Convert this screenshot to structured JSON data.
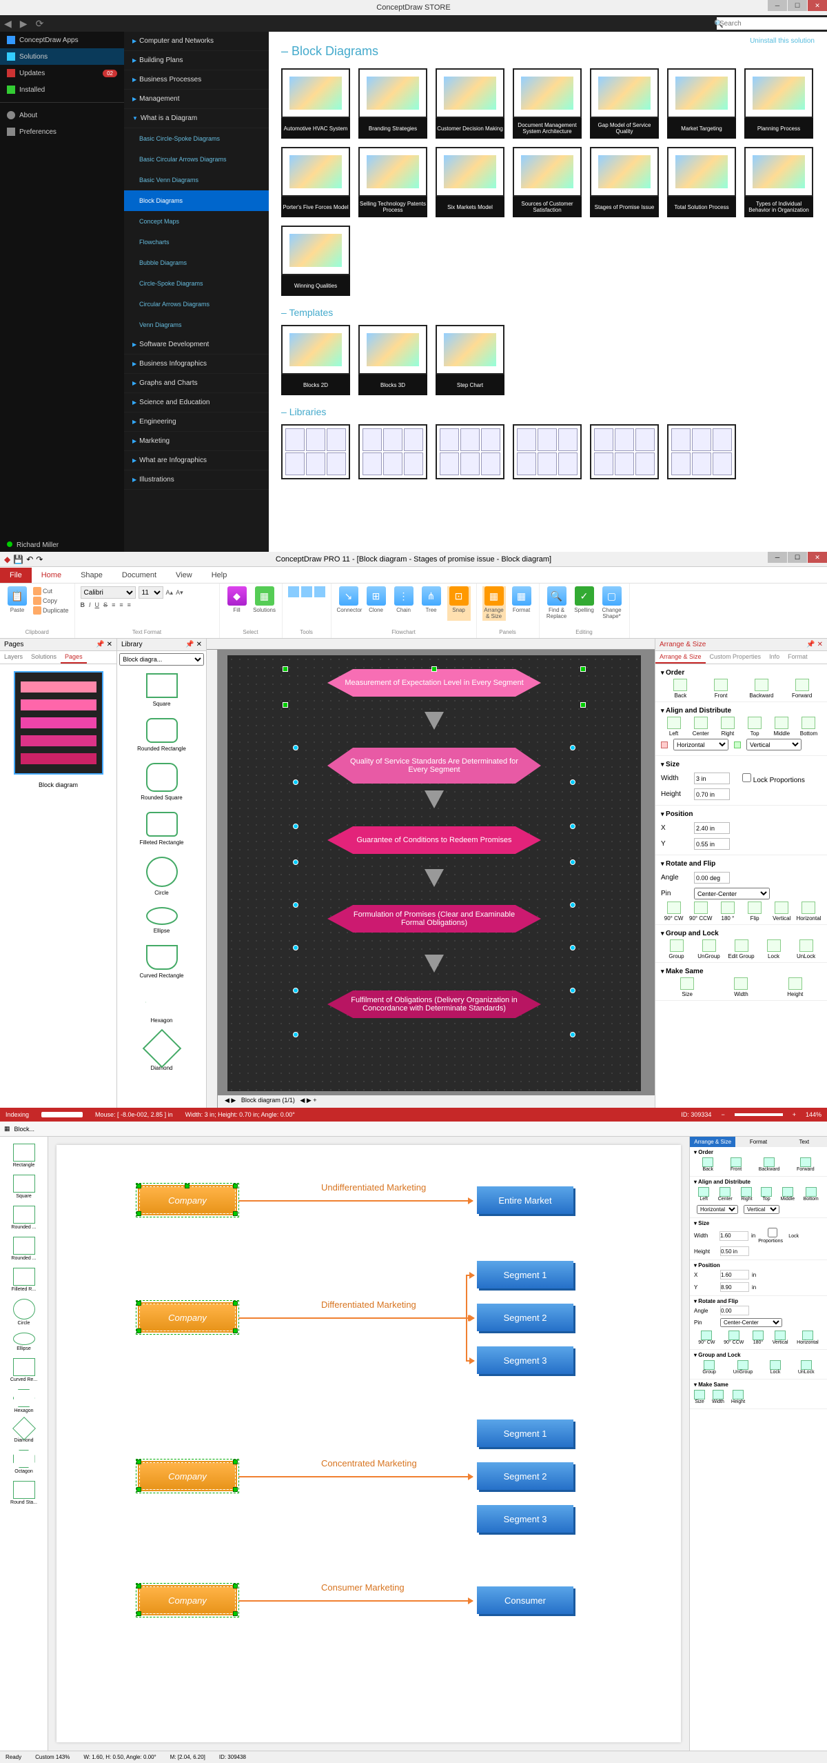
{
  "store": {
    "title": "ConceptDraw STORE",
    "search_placeholder": "Search",
    "uninstall": "Uninstall this solution",
    "leftnav": {
      "apps": "ConceptDraw Apps",
      "solutions": "Solutions",
      "updates": "Updates",
      "updates_badge": "02",
      "installed": "Installed",
      "about": "About",
      "preferences": "Preferences",
      "user": "Richard Miller"
    },
    "categories": [
      "Computer and Networks",
      "Building Plans",
      "Business Processes",
      "Management",
      "What is a Diagram"
    ],
    "subcats": [
      "Basic Circle-Spoke Diagrams",
      "Basic Circular Arrows Diagrams",
      "Basic Venn Diagrams",
      "Block Diagrams",
      "Concept Maps",
      "Flowcharts",
      "Bubble Diagrams",
      "Circle-Spoke Diagrams",
      "Circular Arrows Diagrams",
      "Venn Diagrams"
    ],
    "categories2": [
      "Software Development",
      "Business Infographics",
      "Graphs and Charts",
      "Science and Education",
      "Engineering",
      "Marketing",
      "What are Infographics",
      "Illustrations"
    ],
    "section_block": "Block Diagrams",
    "section_templates": "Templates",
    "section_libraries": "Libraries",
    "thumbs": [
      "Automotive HVAC System",
      "Branding Strategies",
      "Customer Decision Making",
      "Document Management System Architecture",
      "Gap Model of Service Quality",
      "Market Targeting",
      "Planning Process",
      "Porter's Five Forces Model",
      "Selling Technology Patents Process",
      "Six Markets Model",
      "Sources of Customer Satisfaction",
      "Stages of Promise Issue",
      "Total Solution Process",
      "Types of Individual Behavior in Organization",
      "Winning Qualities"
    ],
    "templates": [
      "Blocks 2D",
      "Blocks 3D",
      "Step Chart"
    ]
  },
  "pro": {
    "title": "ConceptDraw PRO 11 - [Block diagram - Stages of promise issue - Block diagram]",
    "tabs": [
      "File",
      "Home",
      "Shape",
      "Document",
      "View",
      "Help"
    ],
    "ribbon": {
      "paste": "Paste",
      "cut": "Cut",
      "copy": "Copy",
      "dup": "Duplicate",
      "font": "Calibri",
      "size": "11",
      "clipboard": "Clipboard",
      "textfmt": "Text Format",
      "fill": "Fill",
      "solutions": "Solutions",
      "select": "Select",
      "tools": "Tools",
      "connector": "Connector",
      "clone": "Clone",
      "chain": "Chain",
      "tree": "Tree",
      "snap": "Snap",
      "arrange": "Arrange & Size",
      "format": "Format",
      "flowchart": "Flowchart",
      "panels": "Panels",
      "find": "Find & Replace",
      "spelling": "Spelling",
      "change": "Change Shape*",
      "editing": "Editing"
    },
    "pages": {
      "title": "Pages",
      "tabs": [
        "Layers",
        "Solutions",
        "Pages"
      ],
      "caption": "Block diagram"
    },
    "library": {
      "title": "Library",
      "combo": "Block diagra...",
      "shapes": [
        "Square",
        "Rounded Rectangle",
        "Rounded Square",
        "Filleted Rectangle",
        "Circle",
        "Ellipse",
        "Curved Rectangle",
        "Hexagon",
        "Diamond"
      ]
    },
    "flow": [
      "Measurement of Expectation Level in Every Segment",
      "Quality of Service Standards Are Determinated for Every Segment",
      "Guarantee of Conditions to Redeem Promises",
      "Formulation of Promises (Clear and Examinable Formal Obligations)",
      "Fulfilment of Obligations (Delivery Organization in Concordance with Determinate Standards)"
    ],
    "canvas_tab": "Block diagram (1/1)",
    "arrange": {
      "title": "Arrange & Size",
      "tabs": [
        "Arrange & Size",
        "Custom Properties",
        "Info",
        "Format"
      ],
      "order": "Order",
      "order_items": [
        "Back",
        "Front",
        "Backward",
        "Forward"
      ],
      "align": "Align and Distribute",
      "align_items": [
        "Left",
        "Center",
        "Right",
        "Top",
        "Middle",
        "Bottom"
      ],
      "horiz": "Horizontal",
      "vert": "Vertical",
      "size": "Size",
      "width_l": "Width",
      "width_v": "3 in",
      "height_l": "Height",
      "height_v": "0.70 in",
      "lock": "Lock Proportions",
      "position": "Position",
      "x": "X",
      "x_v": "2.40 in",
      "y": "Y",
      "y_v": "0.55 in",
      "rotate": "Rotate and Flip",
      "angle_l": "Angle",
      "angle_v": "0.00 deg",
      "pin_l": "Pin",
      "pin_v": "Center-Center",
      "rotate_items": [
        "90° CW",
        "90° CCW",
        "180 °",
        "Flip",
        "Vertical",
        "Horizontal"
      ],
      "group": "Group and Lock",
      "group_items": [
        "Group",
        "UnGroup",
        "Edit Group",
        "Lock",
        "UnLock"
      ],
      "make": "Make Same",
      "make_items": [
        "Size",
        "Width",
        "Height"
      ]
    },
    "status": {
      "indexing": "Indexing",
      "mouse": "Mouse: [ -8.0e-002, 2.85 ] in",
      "dims": "Width: 3 in;  Height: 0.70 in;  Angle: 0.00°",
      "id": "ID: 309334",
      "zoom": "144%"
    }
  },
  "editor2": {
    "tb_block": "Block...",
    "shapes": [
      "Rectangle",
      "Square",
      "Rounded ...",
      "Rounded ...",
      "Filleted R...",
      "Circle",
      "Ellipse",
      "Curved Re...",
      "Hexagon",
      "Diamond",
      "Octagon",
      "Round Sta..."
    ],
    "right": {
      "tabs": [
        "Arrange & Size",
        "Format",
        "Text"
      ],
      "order": "Order",
      "order_i": [
        "Back",
        "Front",
        "Backward",
        "Forward"
      ],
      "align": "Align and Distribute",
      "align_i": [
        "Left",
        "Center",
        "Right",
        "Top",
        "Middle",
        "Bottom"
      ],
      "horiz": "Horizontal",
      "vert": "Vertical",
      "size": "Size",
      "w": "Width",
      "w_v": "1.60",
      "h": "Height",
      "h_v": "0.50 in",
      "lock": "Lock Proportions",
      "pos": "Position",
      "x": "X",
      "x_v": "1.60",
      "y": "Y",
      "y_v": "8.90",
      "in": "in",
      "rotate": "Rotate and Flip",
      "angle": "Angle",
      "angle_v": "0.00",
      "pin": "Pin",
      "pin_v": "Center-Center",
      "rot_i": [
        "90° CW",
        "90° CCW",
        "180°",
        "Vertical",
        "Horizontal"
      ],
      "group": "Group and Lock",
      "group_i": [
        "Group",
        "UnGroup",
        "Lock",
        "UnLock"
      ],
      "make": "Make Same",
      "make_i": [
        "Size",
        "Width",
        "Height"
      ]
    },
    "rows": [
      {
        "left": "Company",
        "label": "Undifferentiated Marketing",
        "rights": [
          "Entire Market"
        ]
      },
      {
        "left": "Company",
        "label": "Differentiated Marketing",
        "rights": [
          "Segment 1",
          "Segment 2",
          "Segment 3"
        ]
      },
      {
        "left": "Company",
        "label": "Concentrated Marketing",
        "rights": [
          "Segment 1",
          "Segment 2",
          "Segment 3"
        ]
      },
      {
        "left": "Company",
        "label": "Consumer Marketing",
        "rights": [
          "Consumer"
        ]
      }
    ],
    "status": {
      "ready": "Ready",
      "custom": "Custom 143%",
      "wh": "W: 1.60,  H: 0.50,  Angle: 0.00°",
      "m": "M: [2.04, 6.20]",
      "id": "ID: 309438"
    }
  }
}
